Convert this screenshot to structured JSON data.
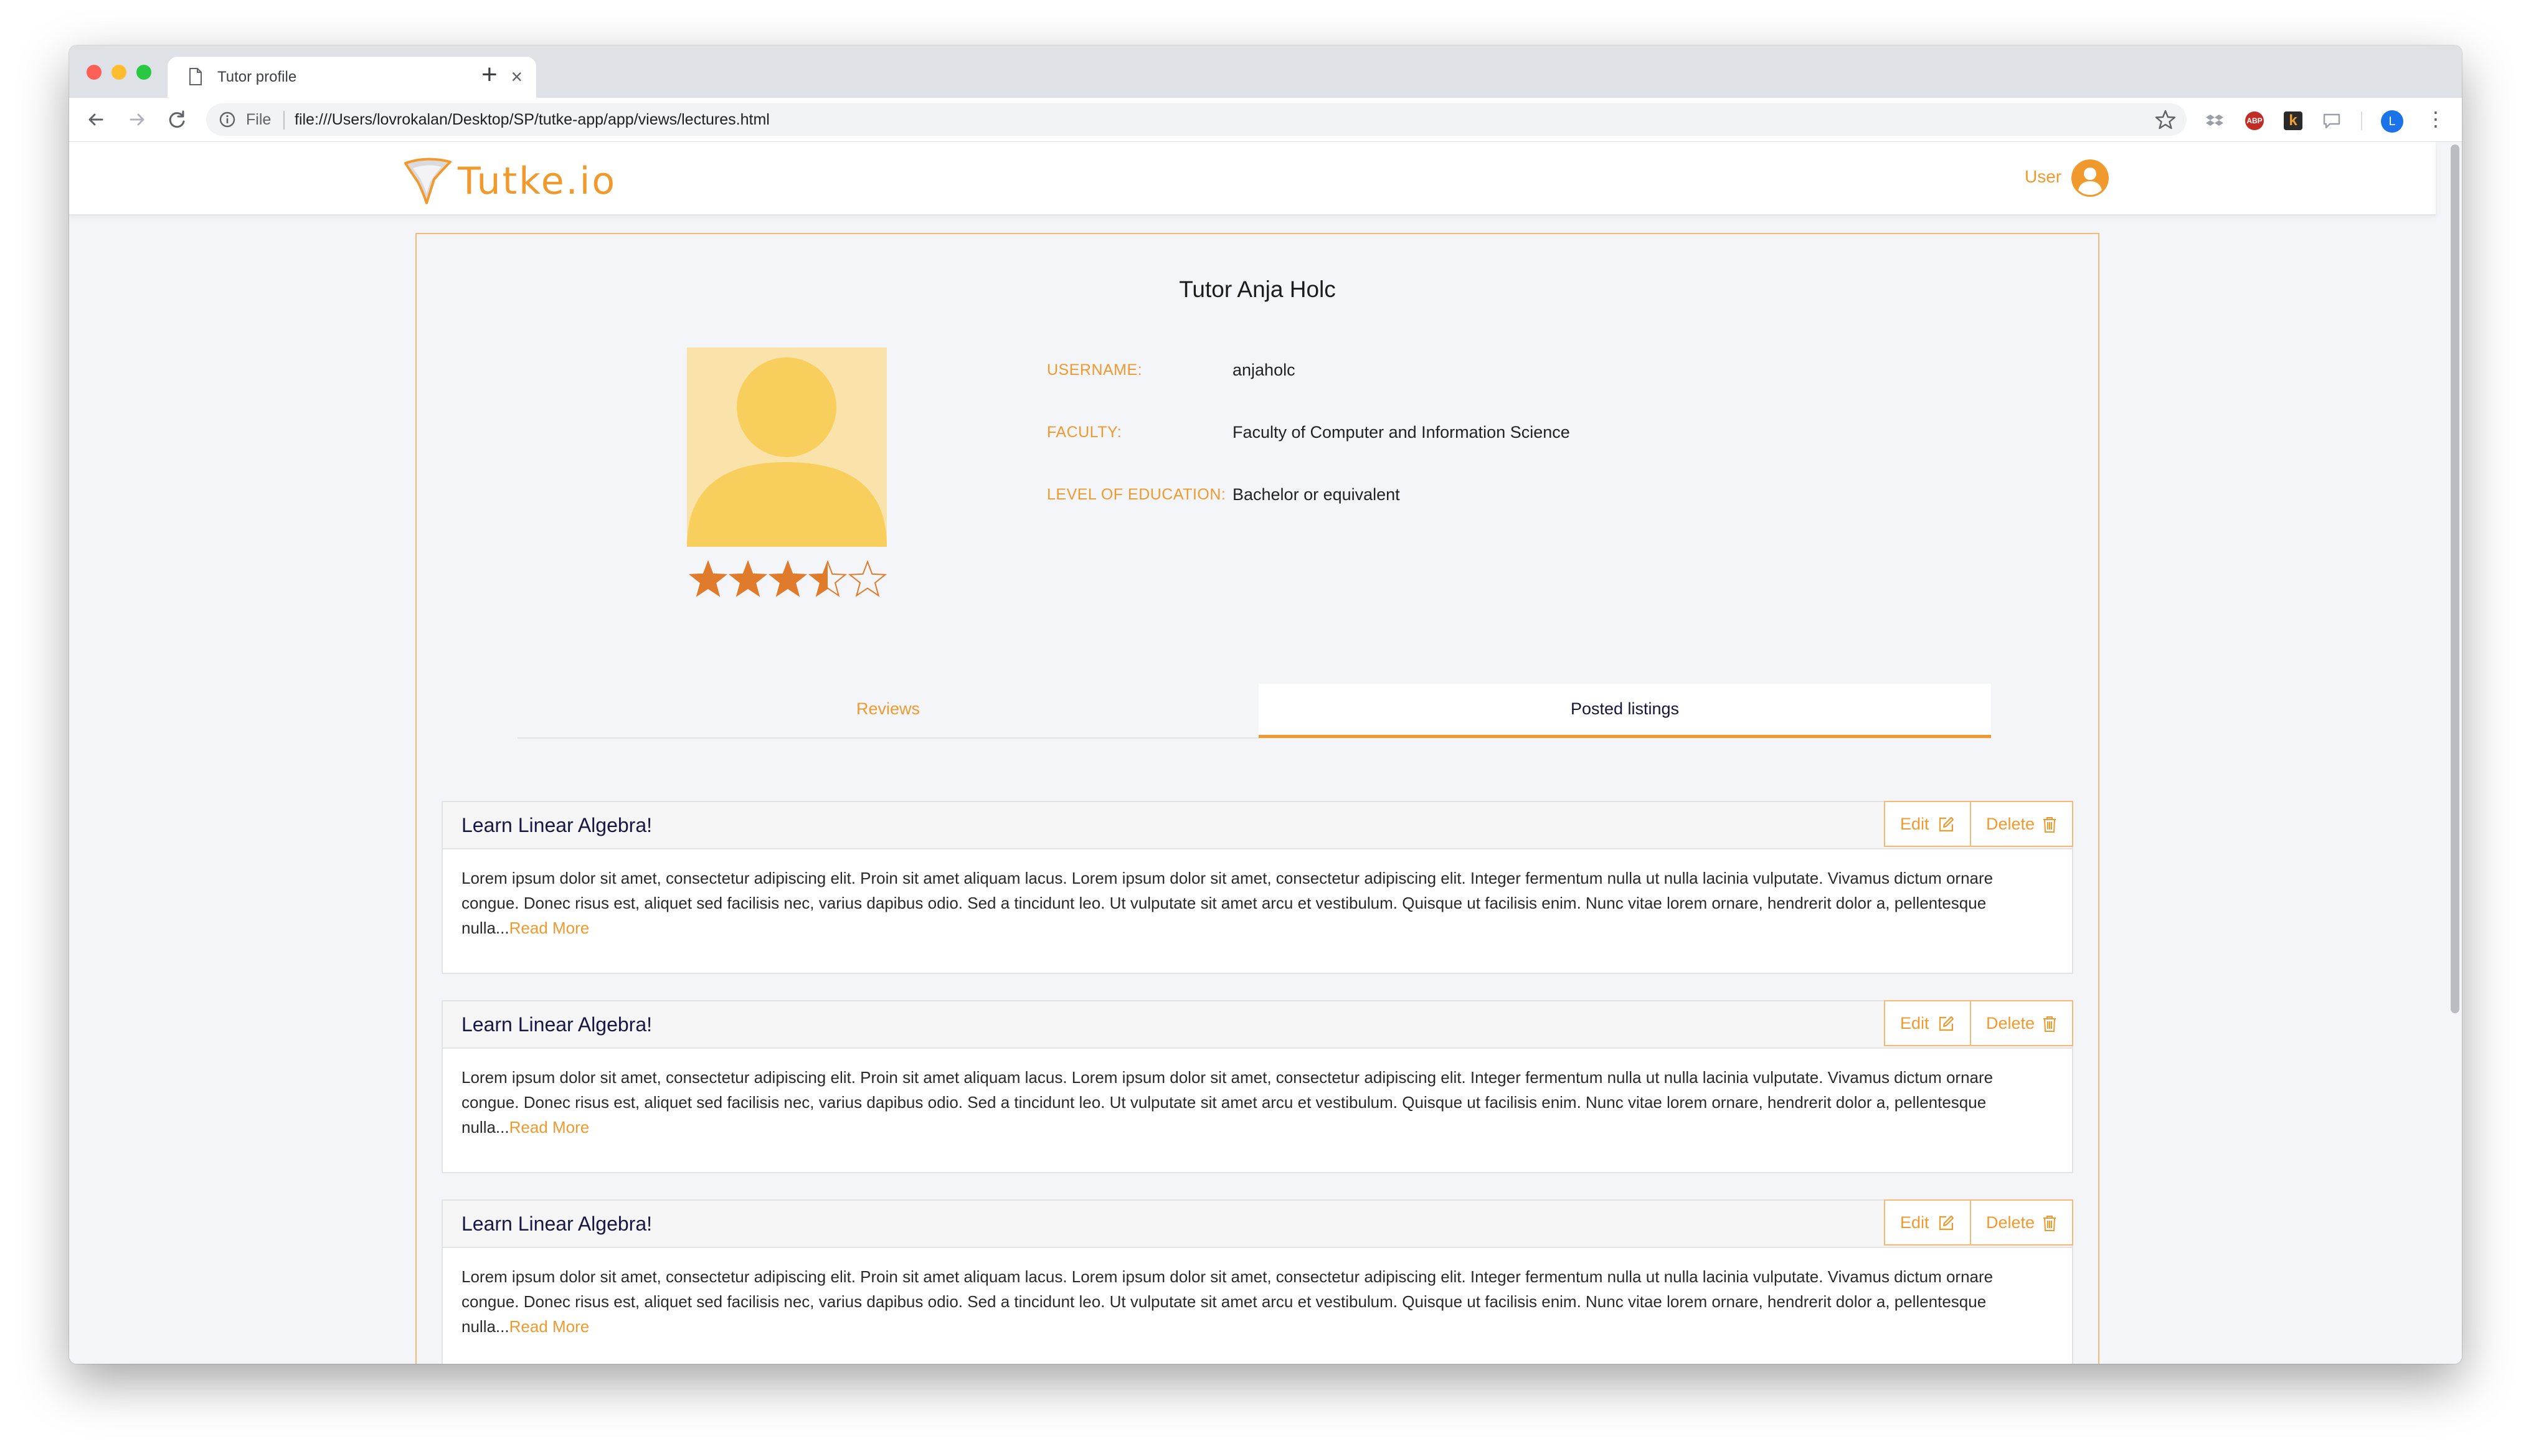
{
  "browser": {
    "tab_title": "Tutor profile",
    "new_tab_symbol": "+",
    "close_tab_symbol": "×",
    "omnibox_scheme_label": "File",
    "url": "file:///Users/lovrokalan/Desktop/SP/tutke-app/app/views/lectures.html",
    "profile_initial": "L",
    "menu_symbol": "⋮",
    "ext_abp_label": "ABP",
    "ext_k_label": "k"
  },
  "header": {
    "logo_text": "Tutke.io",
    "user_label": "User"
  },
  "profile": {
    "title": "Tutor Anja Holc",
    "rating": 3.5,
    "rating_max": 5,
    "fields": [
      {
        "label": "USERNAME:",
        "value": "anjaholc"
      },
      {
        "label": "FACULTY:",
        "value": "Faculty of Computer and Information Science"
      },
      {
        "label": "LEVEL OF EDUCATION:",
        "value": "Bachelor or equivalent"
      }
    ]
  },
  "tabs": [
    {
      "label": "Reviews",
      "active": false
    },
    {
      "label": "Posted listings",
      "active": true
    }
  ],
  "listings": [
    {
      "title": "Learn Linear Algebra!",
      "edit_label": "Edit",
      "delete_label": "Delete",
      "body": "Lorem ipsum dolor sit amet, consectetur adipiscing elit. Proin sit amet aliquam lacus. Lorem ipsum dolor sit amet, consectetur adipiscing elit. Integer fermentum nulla ut nulla lacinia vulputate. Vivamus dictum ornare congue. Donec risus est, aliquet sed facilisis nec, varius dapibus odio. Sed a tincidunt leo. Ut vulputate sit amet arcu et vestibulum. Quisque ut facilisis enim. Nunc vitae lorem ornare, hendrerit dolor a, pellentesque nulla...",
      "read_more": "Read More"
    },
    {
      "title": "Learn Linear Algebra!",
      "edit_label": "Edit",
      "delete_label": "Delete",
      "body": "Lorem ipsum dolor sit amet, consectetur adipiscing elit. Proin sit amet aliquam lacus. Lorem ipsum dolor sit amet, consectetur adipiscing elit. Integer fermentum nulla ut nulla lacinia vulputate. Vivamus dictum ornare congue. Donec risus est, aliquet sed facilisis nec, varius dapibus odio. Sed a tincidunt leo. Ut vulputate sit amet arcu et vestibulum. Quisque ut facilisis enim. Nunc vitae lorem ornare, hendrerit dolor a, pellentesque nulla...",
      "read_more": "Read More"
    },
    {
      "title": "Learn Linear Algebra!",
      "edit_label": "Edit",
      "delete_label": "Delete",
      "body": "Lorem ipsum dolor sit amet, consectetur adipiscing elit. Proin sit amet aliquam lacus. Lorem ipsum dolor sit amet, consectetur adipiscing elit. Integer fermentum nulla ut nulla lacinia vulputate. Vivamus dictum ornare congue. Donec risus est, aliquet sed facilisis nec, varius dapibus odio. Sed a tincidunt leo. Ut vulputate sit amet arcu et vestibulum. Quisque ut facilisis enim. Nunc vitae lorem ornare, hendrerit dolor a, pellentesque nulla...",
      "read_more": "Read More"
    }
  ],
  "colors": {
    "accent": "#f09a2e",
    "star": "#e07b2c",
    "avatar_bg": "#f9e3aa",
    "avatar_fg": "#f8cf5c"
  },
  "icons": [
    "page-icon",
    "back-icon",
    "forward-icon",
    "reload-icon",
    "info-icon",
    "bookmark-star-icon",
    "dropbox-icon",
    "message-icon",
    "logo-icon",
    "user-avatar-icon",
    "edit-icon",
    "trash-icon",
    "star-icon"
  ]
}
